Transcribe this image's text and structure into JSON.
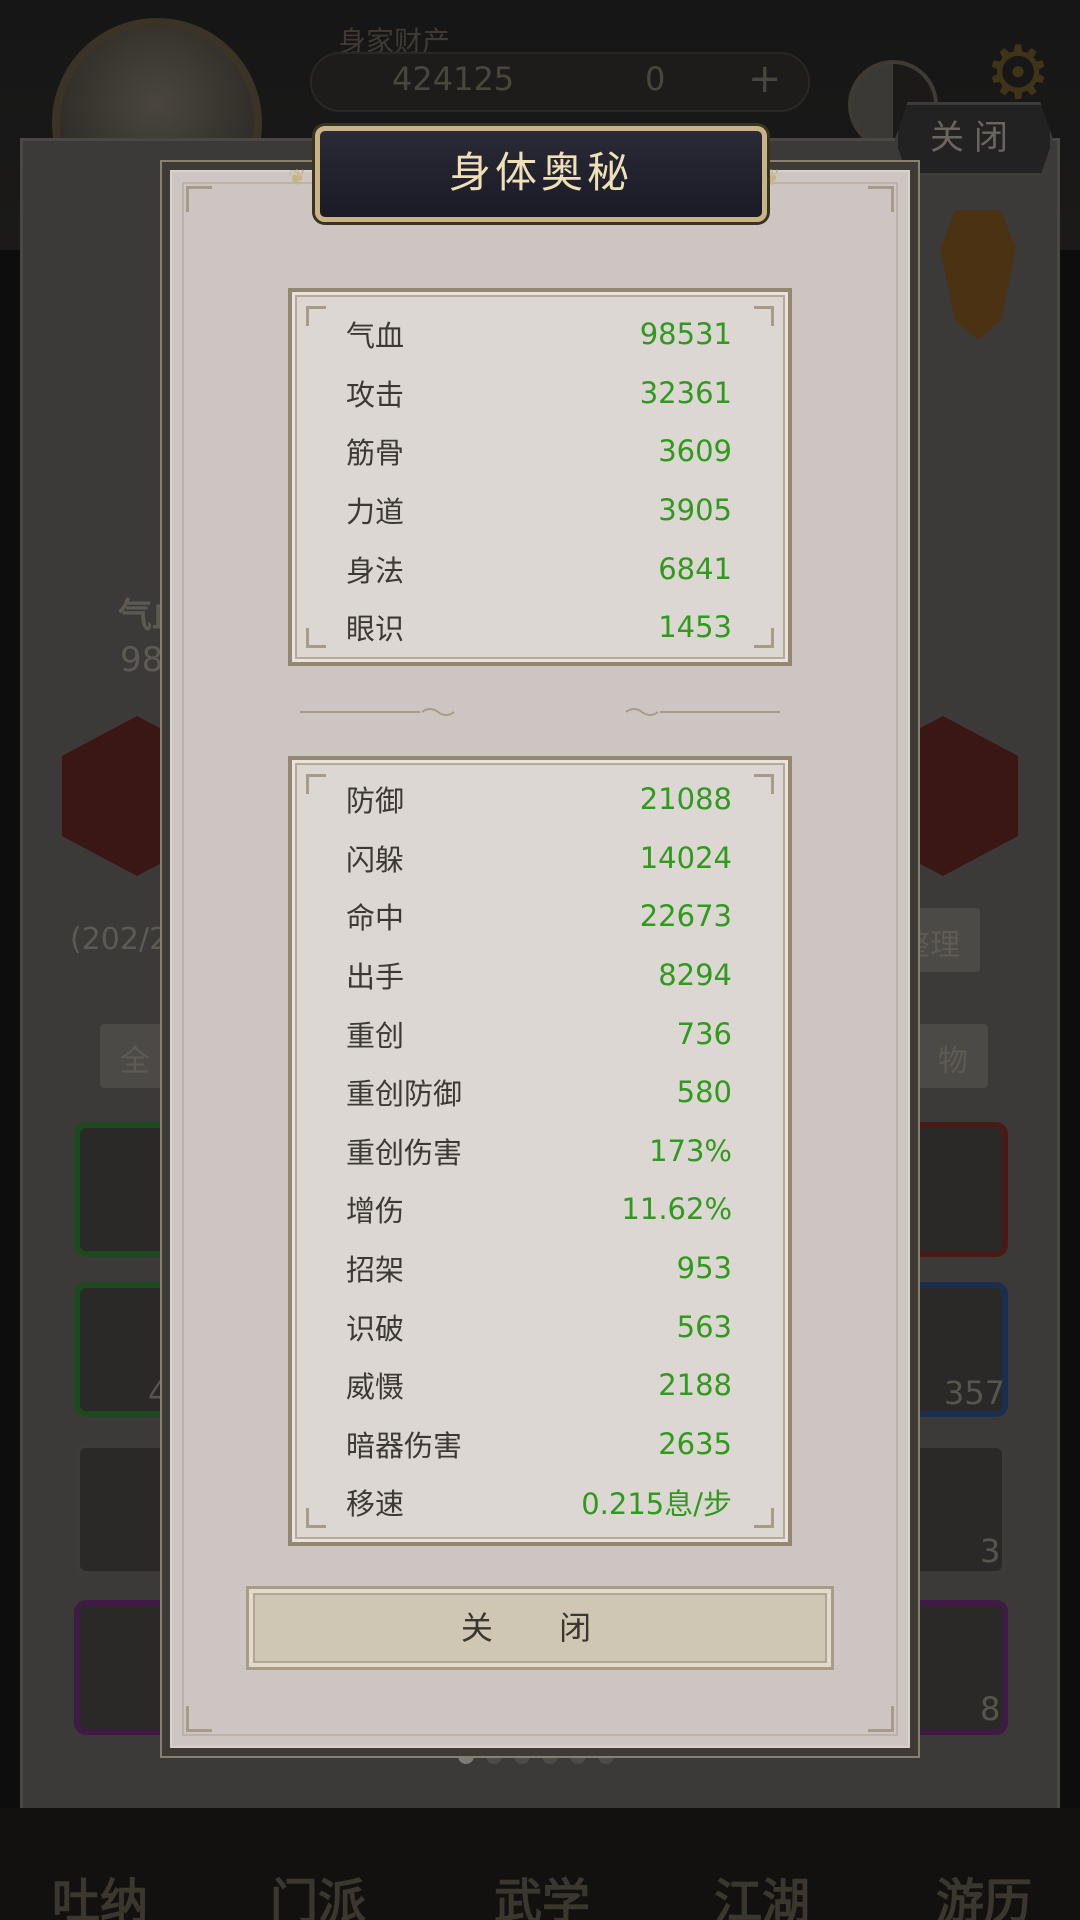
{
  "background": {
    "asset_label": "身家财产",
    "coins": "424125",
    "jade": "0",
    "plus": "+",
    "close_top": "关闭",
    "left_stat_label": "气血",
    "left_stat_value": "985",
    "capacity": "(202/2",
    "organize": "整理",
    "filter_all": "全",
    "filter_items": "物",
    "slot_counts": [
      "45",
      "357",
      "3",
      "8"
    ],
    "nav": [
      "吐纳",
      "门派",
      "武学",
      "江湖",
      "游历"
    ]
  },
  "modal": {
    "title": "身体奥秘",
    "close_button": "关 闭",
    "primary_stats": [
      {
        "label": "气血",
        "value": "98531"
      },
      {
        "label": "攻击",
        "value": "32361"
      },
      {
        "label": "筋骨",
        "value": "3609"
      },
      {
        "label": "力道",
        "value": "3905"
      },
      {
        "label": "身法",
        "value": "6841"
      },
      {
        "label": "眼识",
        "value": "1453"
      }
    ],
    "secondary_stats": [
      {
        "label": "防御",
        "value": "21088"
      },
      {
        "label": "闪躲",
        "value": "14024"
      },
      {
        "label": "命中",
        "value": "22673"
      },
      {
        "label": "出手",
        "value": "8294"
      },
      {
        "label": "重创",
        "value": "736"
      },
      {
        "label": "重创防御",
        "value": "580"
      },
      {
        "label": "重创伤害",
        "value": "173%"
      },
      {
        "label": "增伤",
        "value": "11.62%"
      },
      {
        "label": "招架",
        "value": "953"
      },
      {
        "label": "识破",
        "value": "563"
      },
      {
        "label": "威慑",
        "value": "2188"
      },
      {
        "label": "暗器伤害",
        "value": "2635"
      },
      {
        "label": "移速",
        "value": "0.215息/步"
      }
    ]
  },
  "colors": {
    "value_green": "#2f9a1c",
    "title_gold": "#efe0b8",
    "modal_bg": "#cdc5c2"
  }
}
